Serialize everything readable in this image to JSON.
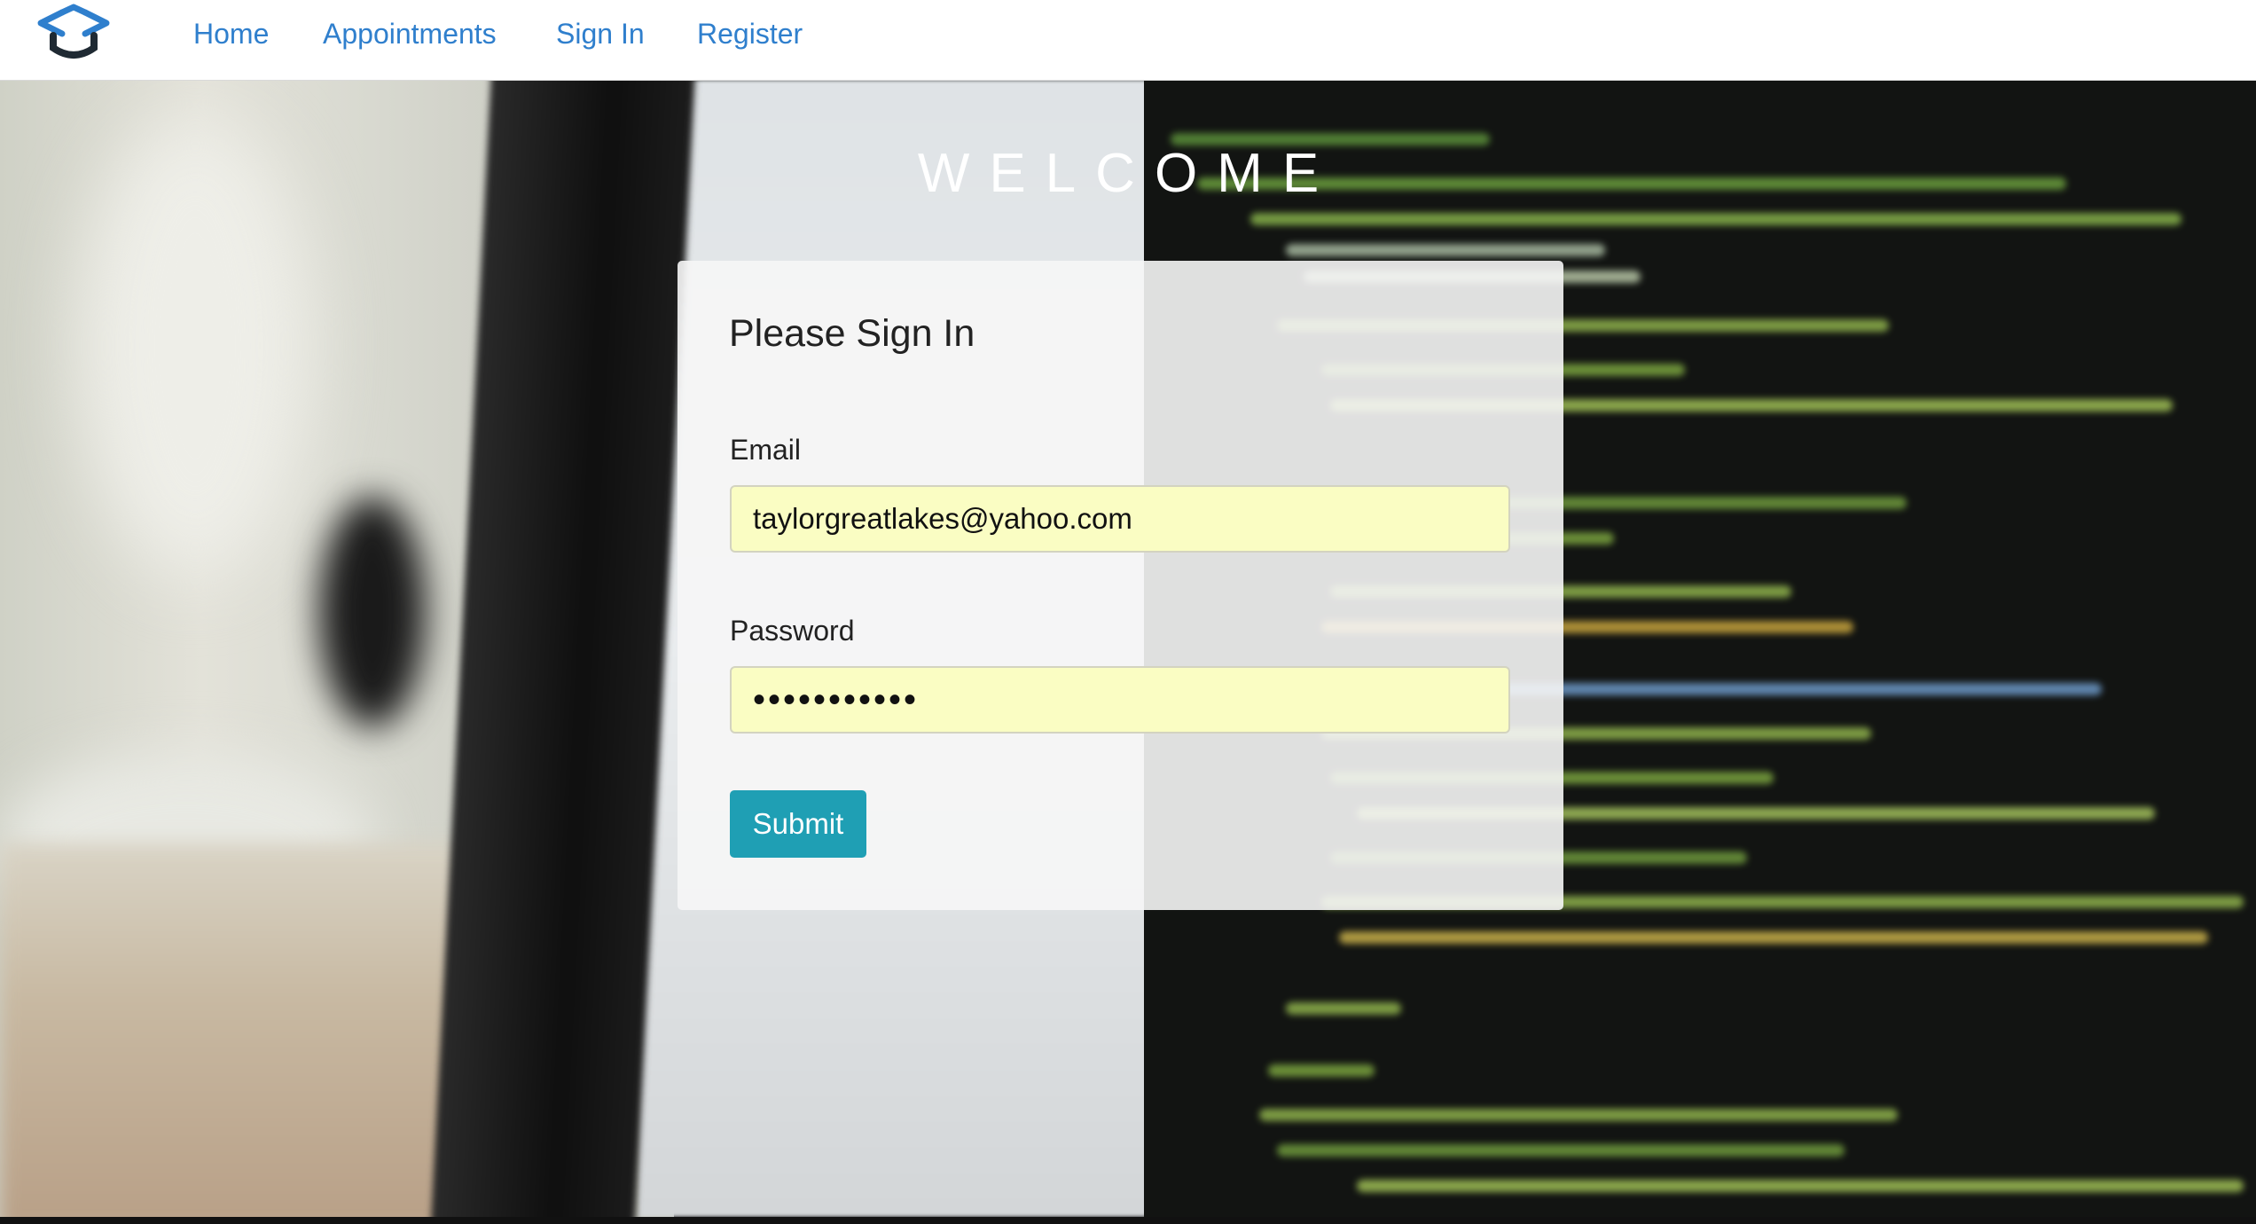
{
  "nav": {
    "logo": "graduation-cap-code-icon",
    "links": [
      {
        "label": "Home"
      },
      {
        "label": "Appointments"
      },
      {
        "label": "Sign In"
      },
      {
        "label": "Register"
      }
    ],
    "link_color": "#2f7fcd"
  },
  "hero": {
    "heading": "WELCOME"
  },
  "signin": {
    "title": "Please Sign In",
    "email_label": "Email",
    "email_value": "taylorgreatlakes@yahoo.com",
    "password_label": "Password",
    "password_value": "•••••••••••",
    "submit_label": "Submit"
  },
  "colors": {
    "input_autofill_bg": "#fafdc3",
    "submit_bg": "#1f9fb4",
    "card_bg": "#f6f6f6"
  }
}
